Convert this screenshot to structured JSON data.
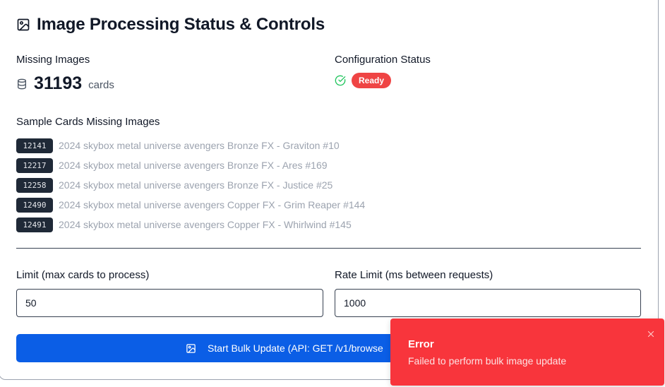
{
  "header": {
    "title": "Image Processing Status & Controls",
    "icon": "image-icon"
  },
  "missing": {
    "label": "Missing Images",
    "count": "31193",
    "unit": "cards",
    "icon": "database-icon"
  },
  "config": {
    "label": "Configuration Status",
    "status": "Ready",
    "icon": "check-circle-icon",
    "badge_color": "#ef4444"
  },
  "samples": {
    "label": "Sample Cards Missing Images",
    "items": [
      {
        "id": "12141",
        "name": "2024 skybox metal universe avengers Bronze FX - Graviton #10"
      },
      {
        "id": "12217",
        "name": "2024 skybox metal universe avengers Bronze FX - Ares #169"
      },
      {
        "id": "12258",
        "name": "2024 skybox metal universe avengers Bronze FX - Justice #25"
      },
      {
        "id": "12490",
        "name": "2024 skybox metal universe avengers Copper FX - Grim Reaper #144"
      },
      {
        "id": "12491",
        "name": "2024 skybox metal universe avengers Copper FX - Whirlwind #145"
      }
    ]
  },
  "form": {
    "limit_label": "Limit (max cards to process)",
    "limit_value": "50",
    "rate_label": "Rate Limit (ms between requests)",
    "rate_value": "1000"
  },
  "actions": {
    "start_label": "Start Bulk Update (API: GET /v1/browse",
    "button_color": "#0b5ee6"
  },
  "toast": {
    "title": "Error",
    "message": "Failed to perform bulk image update",
    "color": "#f8353c",
    "close_icon": "close-icon"
  }
}
